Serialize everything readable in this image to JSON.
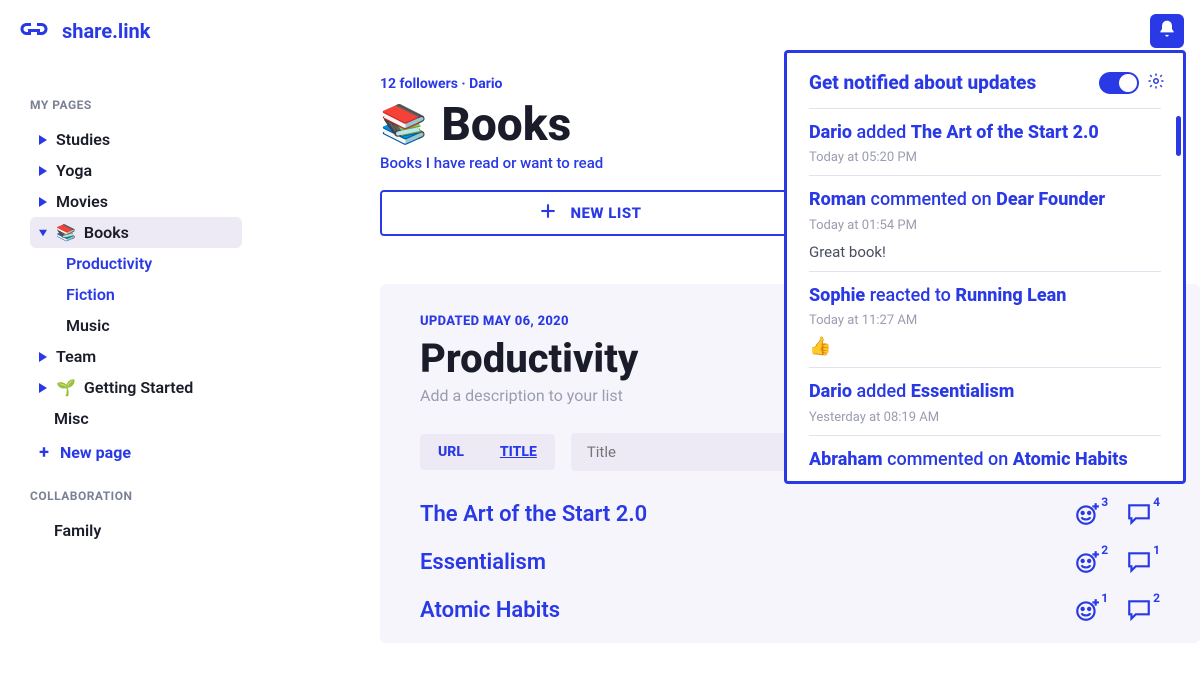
{
  "app": {
    "name": "share.link"
  },
  "sidebar": {
    "section1": "MY PAGES",
    "section2": "COLLABORATION",
    "items": [
      {
        "label": "Studies"
      },
      {
        "label": "Yoga"
      },
      {
        "label": "Movies"
      },
      {
        "label": "Books"
      },
      {
        "label": "Productivity"
      },
      {
        "label": "Fiction"
      },
      {
        "label": "Music"
      },
      {
        "label": "Team"
      },
      {
        "label": "Getting Started"
      },
      {
        "label": "Misc"
      }
    ],
    "new_page": "New page",
    "collab_items": [
      {
        "label": "Family"
      }
    ]
  },
  "page": {
    "meta": "12 followers   ·   Dario",
    "title": "Books",
    "icon": "📚",
    "subtitle": "Books I have read or want to read",
    "new_list": "NEW LIST"
  },
  "list": {
    "updated": "UPDATED MAY 06, 2020",
    "title": "Productivity",
    "desc_placeholder": "Add a description to your list",
    "tabs": {
      "url": "URL",
      "title": "TITLE"
    },
    "search_placeholder": "Title",
    "items": [
      {
        "title": "The Art of the Start 2.0",
        "reactions": 3,
        "comments": 4
      },
      {
        "title": "Essentialism",
        "reactions": 2,
        "comments": 1
      },
      {
        "title": "Atomic Habits",
        "reactions": 1,
        "comments": 2
      }
    ]
  },
  "notifications": {
    "header": "Get notified about updates",
    "items": [
      {
        "actor": "Dario",
        "verb": "added",
        "target": "The Art of the Start 2.0",
        "time": "Today at 05:20 PM"
      },
      {
        "actor": "Roman",
        "verb": "commented on",
        "target": "Dear Founder",
        "time": "Today at 01:54 PM",
        "body": "Great book!"
      },
      {
        "actor": "Sophie",
        "verb": "reacted to",
        "target": "Running Lean",
        "time": "Today at 11:27 AM",
        "emoji": "👍"
      },
      {
        "actor": "Dario",
        "verb": "added",
        "target": "Essentialism",
        "time": "Yesterday at 08:19 AM"
      },
      {
        "actor": "Abraham",
        "verb": "commented on",
        "target": "Atomic Habits",
        "time": ""
      }
    ]
  }
}
